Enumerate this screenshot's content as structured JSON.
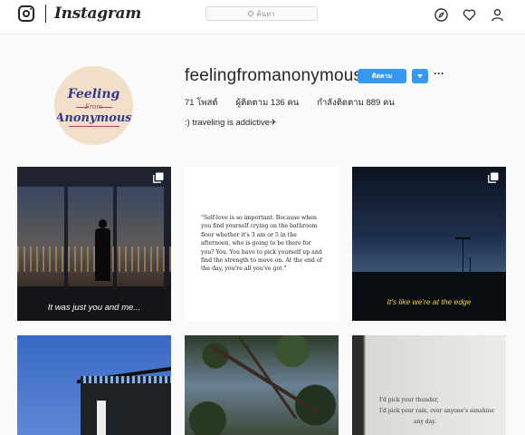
{
  "nav": {
    "brand": "Instagram",
    "search_placeholder": "ค้นหา",
    "icons": [
      "compass-icon",
      "heart-icon",
      "person-icon"
    ]
  },
  "profile": {
    "avatar_text": [
      "Feeling",
      "From",
      "Anonymous"
    ],
    "username": "feelingfromanonymous",
    "follow_label": "ติดตาม",
    "more_label": "···",
    "stats": {
      "posts": "71 โพสต์",
      "followers": "ผู้ติดตาม 136 คน",
      "following": "กำลังติดตาม 889 คน"
    },
    "bio": ":) traveling is addictive✈"
  },
  "posts": [
    {
      "caption": "It was just you and me...",
      "multi": true
    },
    {
      "quote": "\"Self-love is so important. Because when you find yourself crying on the bathroom floor whether it's 3 am or 5 in the afternoon, who is going to be there for you? You. You have to pick yourself up and find the strength to move on. At the end of the day, you're all you've got.\"",
      "multi": false
    },
    {
      "caption": "It's like we're at the edge",
      "multi": true
    },
    {
      "multi": false
    },
    {
      "multi": false
    },
    {
      "book_lines": [
        "I'd pick your thunder,",
        "I'd pick your rain, over anyone's sunshine",
        "any day."
      ],
      "multi": false
    }
  ],
  "colors": {
    "accent_blue": "#3897f0",
    "caption_yellow": "#f2d23a",
    "avatar_bg": "#f2dfc9",
    "avatar_navy": "#343a86",
    "avatar_pink": "#a93b6e"
  }
}
